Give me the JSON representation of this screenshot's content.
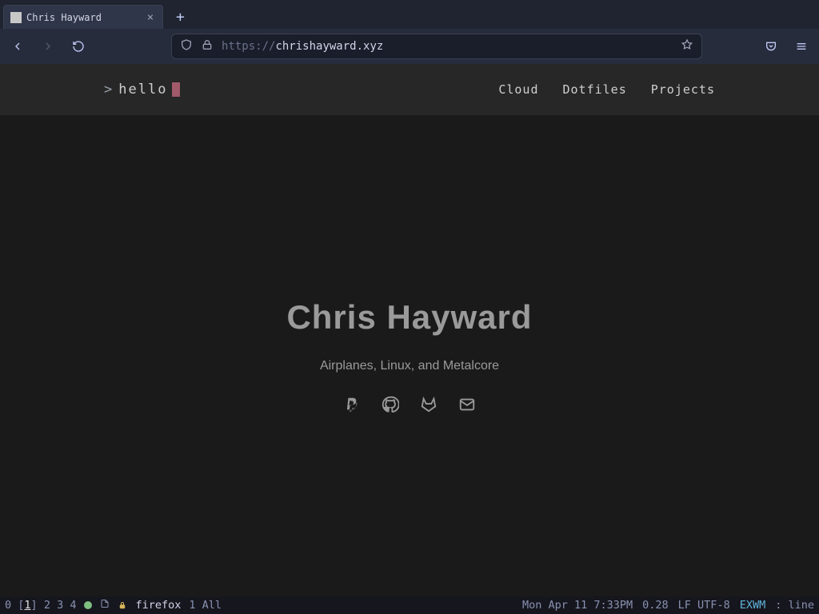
{
  "browser": {
    "tab_title": "Chris Hayward",
    "url_proto": "https://",
    "url_host": "chrishayward.xyz"
  },
  "site": {
    "logo_prompt": ">",
    "logo_text": "hello",
    "nav": {
      "cloud": "Cloud",
      "dotfiles": "Dotfiles",
      "projects": "Projects"
    },
    "hero_title": "Chris Hayward",
    "hero_tagline": "Airplanes, Linux, and Metalcore"
  },
  "modeline": {
    "ws_prefix": "0",
    "ws_current": "1",
    "ws_rest": "2  3  4",
    "buffer": "firefox",
    "pos": "1 All",
    "clock": "Mon Apr 11 7:33PM",
    "load": "0.28",
    "enc": "LF UTF-8",
    "mode": "EXWM",
    "tail": ": line"
  }
}
